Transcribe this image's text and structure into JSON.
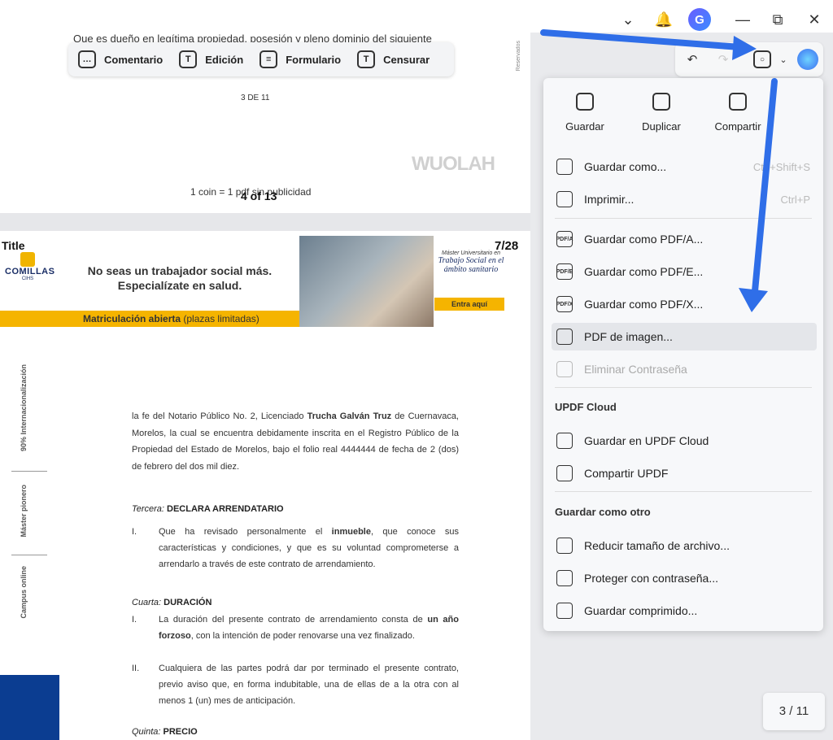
{
  "titlebar": {
    "avatar_letter": "G"
  },
  "doc_top": {
    "cut_text": "Que es dueño en legítima propiedad, posesión y pleno dominio del siguiente",
    "page_small": "3 DE 11",
    "watermark": "WUOLAH",
    "coin_text": "1 coin = 1 pdf sin publicidad",
    "page_of": "4 of 13",
    "reservados": "Reservados"
  },
  "float_toolbar": {
    "items": [
      {
        "label": "Comentario",
        "icon": "comment-icon"
      },
      {
        "label": "Edición",
        "icon": "edit-icon"
      },
      {
        "label": "Formulario",
        "icon": "form-icon"
      },
      {
        "label": "Censurar",
        "icon": "redact-icon"
      }
    ]
  },
  "banner": {
    "title": "Title",
    "page_num": "7/28",
    "logo_name": "COMILLAS",
    "logo_sub": "CIHS",
    "headline_1": "No seas un trabajador social más.",
    "headline_2": "Especialízate en salud.",
    "yellow_bold": "Matriculación abierta",
    "yellow_light": "(plazas limitadas)",
    "master_small": "Máster Universitario en",
    "master_title": "Trabajo Social en el ámbito sanitario",
    "cta": "Entra aquí"
  },
  "side_labels": [
    "90% Internacionalización",
    "Máster pionero",
    "Campus online"
  ],
  "document": {
    "p1_pre": "la fe del Notario Público No. 2, Licenciado ",
    "p1_bold": "Trucha Galván Truz",
    "p1_post": " de Cuernavaca, Morelos, la cual se encuentra debidamente inscrita en el Registro Público de la Propiedad del Estado de Morelos, bajo el folio real 4444444 de fecha de 2 (dos) de febrero del dos mil diez.",
    "h3_italic": "Tercera:",
    "h3_bold": "DECLARA ARRENDATARIO",
    "l3_num": "I.",
    "l3_pre": "Que ha revisado personalmente el ",
    "l3_bold": "inmueble",
    "l3_post": ", que conoce sus características y condiciones, y que es su voluntad comprometerse a arrendarlo a través de este contrato de arrendamiento.",
    "h4_italic": "Cuarta:",
    "h4_bold": "DURACIÓN",
    "l4a_num": "I.",
    "l4a_pre": "La duración del presente contrato de arrendamiento consta de ",
    "l4a_bold": "un año forzoso",
    "l4a_post": ", con la intención de poder renovarse una vez finalizado.",
    "l4b_num": "II.",
    "l4b_text": "Cualquiera de las partes podrá dar por terminado el presente contrato, previo aviso que, en forma indubitable, una de ellas de a la otra con al menos 1 (un) mes de anticipación.",
    "h5_italic": "Quinta:",
    "h5_bold": "PRECIO"
  },
  "save_menu": {
    "quick": [
      {
        "label": "Guardar",
        "icon": "save-icon"
      },
      {
        "label": "Duplicar",
        "icon": "duplicate-icon"
      },
      {
        "label": "Compartir",
        "icon": "share-icon"
      }
    ],
    "items": [
      {
        "label": "Guardar como...",
        "shortcut": "Ctrl+Shift+S",
        "icon": "save-as-icon"
      },
      {
        "label": "Imprimir...",
        "shortcut": "Ctrl+P",
        "icon": "print-icon"
      },
      {
        "label": "Guardar como PDF/A...",
        "icon": "pdfa-icon",
        "badge": "PDF/A"
      },
      {
        "label": "Guardar como PDF/E...",
        "icon": "pdfe-icon",
        "badge": "PDF/E"
      },
      {
        "label": "Guardar como PDF/X...",
        "icon": "pdfx-icon",
        "badge": "PDF/X"
      },
      {
        "label": "PDF de imagen...",
        "icon": "image-pdf-icon"
      },
      {
        "label": "Eliminar Contraseña",
        "icon": "remove-password-icon",
        "disabled": true
      }
    ],
    "cloud_title": "UPDF Cloud",
    "cloud_items": [
      {
        "label": "Guardar en UPDF Cloud",
        "icon": "cloud-upload-icon"
      },
      {
        "label": "Compartir UPDF",
        "icon": "link-icon"
      }
    ],
    "other_title": "Guardar como otro",
    "other_items": [
      {
        "label": "Reducir tamaño de archivo...",
        "icon": "reduce-size-icon"
      },
      {
        "label": "Proteger con contraseña...",
        "icon": "protect-icon"
      },
      {
        "label": "Guardar comprimido...",
        "icon": "compress-icon"
      }
    ]
  },
  "page_counter": "3 / 11",
  "colors": {
    "accent_arrow": "#2f6ee8",
    "banner_yellow": "#f5b400",
    "brand_blue": "#0b3d91"
  }
}
